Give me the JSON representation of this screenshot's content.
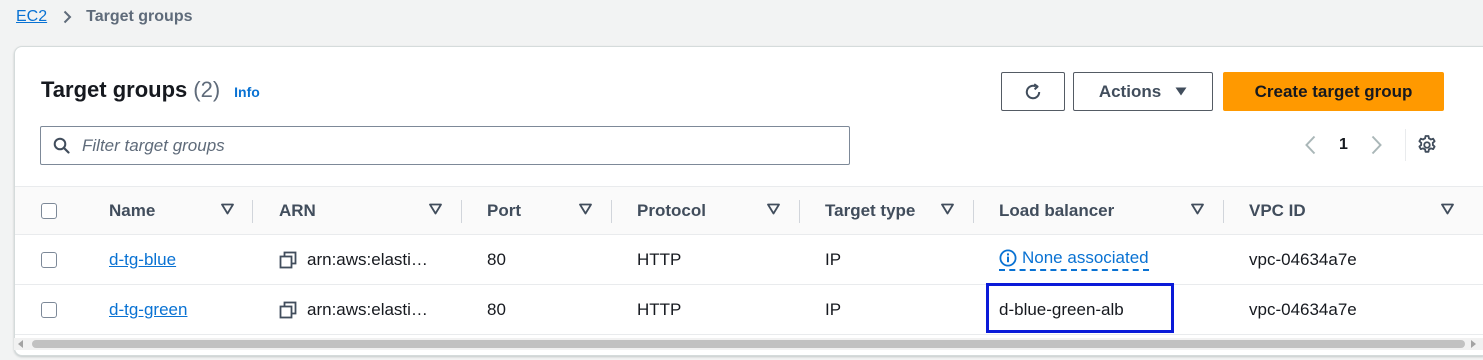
{
  "breadcrumb": {
    "root": "EC2",
    "current": "Target groups"
  },
  "header": {
    "title": "Target groups",
    "count": "(2)",
    "info": "Info"
  },
  "toolbar": {
    "actions_label": "Actions",
    "create_label": "Create target group"
  },
  "search": {
    "placeholder": "Filter target groups",
    "value": ""
  },
  "pagination": {
    "current_page": "1"
  },
  "table": {
    "columns": [
      "Name",
      "ARN",
      "Port",
      "Protocol",
      "Target type",
      "Load balancer",
      "VPC ID"
    ],
    "rows": [
      {
        "name": "d-tg-blue",
        "arn": "arn:aws:elasti…",
        "port": "80",
        "protocol": "HTTP",
        "target_type": "IP",
        "load_balancer": "None associated",
        "vpc_id": "vpc-04634a7e"
      },
      {
        "name": "d-tg-green",
        "arn": "arn:aws:elasti…",
        "port": "80",
        "protocol": "HTTP",
        "target_type": "IP",
        "load_balancer": "d-blue-green-alb",
        "vpc_id": "vpc-04634a7e"
      }
    ]
  },
  "colors": {
    "accent": "#0972d3",
    "primary_button": "#ff9900",
    "highlight_box": "#0a1ad8"
  }
}
